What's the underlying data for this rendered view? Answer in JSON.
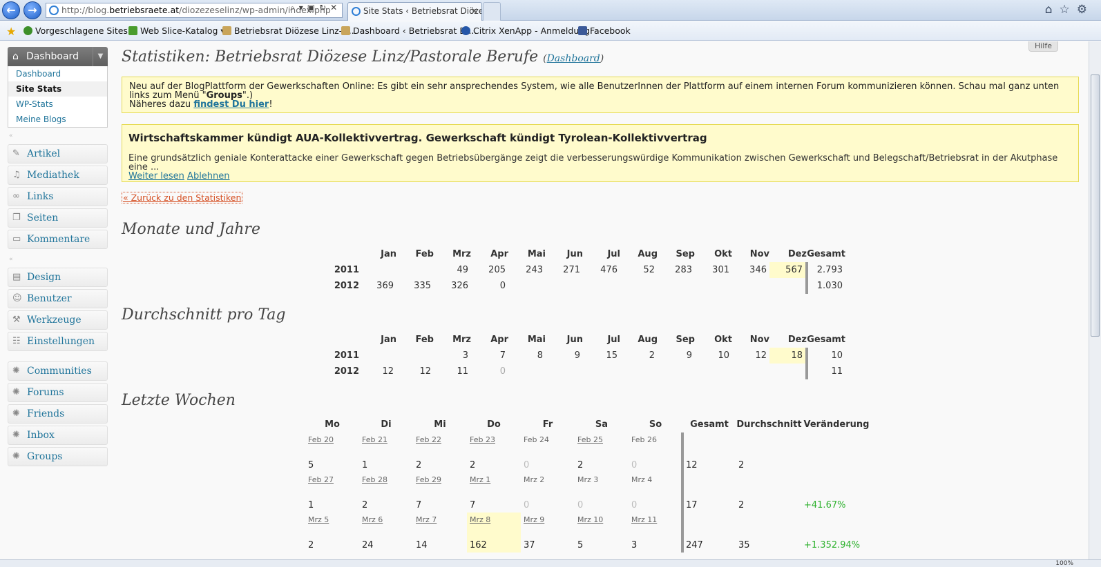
{
  "browser": {
    "url_prefix": "http://blog.",
    "url_domain": "betriebsraete.at",
    "url_path": "/diozezeselinz/wp-admin/index.php",
    "tab_title": "Site Stats ‹ Betriebsrat Diöze...",
    "tab_close": "✕",
    "favorites": [
      {
        "label": "Vorgeschlagene Sites ▾"
      },
      {
        "label": "Web Slice-Katalog ▾"
      },
      {
        "label": "Betriebsrat Diözese Linz-P..."
      },
      {
        "label": "Dashboard ‹ Betriebsrat Di..."
      },
      {
        "label": "Citrix XenApp - Anmeldung"
      },
      {
        "label": "Facebook"
      }
    ],
    "zoom": "100%",
    "colors": {
      "link": "#21759b",
      "notice_bg": "#fffbcc",
      "positive": "#2db12d",
      "back_link": "#d54e21"
    }
  },
  "sidebar": {
    "dashboard_label": "Dashboard",
    "sub_items": [
      "Dashboard",
      "Site Stats",
      "WP-Stats",
      "Meine Blogs"
    ],
    "group1": [
      "Artikel",
      "Mediathek",
      "Links",
      "Seiten",
      "Kommentare"
    ],
    "group2": [
      "Design",
      "Benutzer",
      "Werkzeuge",
      "Einstellungen"
    ],
    "group3": [
      "Communities",
      "Forums",
      "Friends",
      "Inbox",
      "Groups"
    ]
  },
  "main": {
    "help_label": "Hilfe",
    "title": "Statistiken: Betriebsrat Diözese Linz/Pastorale Berufe",
    "title_link": "Dashboard",
    "notice1": {
      "text_a": "Neu auf der BlogPlattform der Gewerkschaften Online: Es gibt ein sehr ansprechendes System, wie alle BenutzerInnen der Plattform auf einem internen Forum kommunizieren können. Schau mal ganz unten links zum Menü \"",
      "bold": "Groups",
      "text_b": "\".)",
      "line2_a": "Näheres dazu ",
      "link": "findest Du hier",
      "line2_b": "!"
    },
    "notice2": {
      "heading": "Wirtschaftskammer kündigt AUA-Kollektivvertrag. Gewerkschaft kündigt Tyrolean-Kollektivvertrag",
      "text": "Eine grundsätzlich geniale Konterattacke einer Gewerkschaft gegen Betriebsübergänge zeigt die verbesserungswürdige Kommunikation zwischen Gewerkschaft und Belegschaft/Betriebsrat in der Akutphase eine ...",
      "read_more": "Weiter lesen",
      "dismiss": "Ablehnen"
    },
    "back_link": "« Zurück zu den Statistiken",
    "months_title": "Monate und Jahre",
    "avg_title": "Durchschnitt pro Tag",
    "weeks_title": "Letzte Wochen",
    "month_headers": [
      "Jan",
      "Feb",
      "Mrz",
      "Apr",
      "Mai",
      "Jun",
      "Jul",
      "Aug",
      "Sep",
      "Okt",
      "Nov",
      "Dez",
      "Gesamt"
    ],
    "months": [
      {
        "year": "2011",
        "values": [
          "",
          "",
          "49",
          "205",
          "243",
          "271",
          "476",
          "52",
          "283",
          "301",
          "346",
          "567"
        ],
        "total": "2.793"
      },
      {
        "year": "2012",
        "values": [
          "369",
          "335",
          "326",
          "0",
          "",
          "",
          "",
          "",
          "",
          "",
          "",
          ""
        ],
        "total": "1.030"
      }
    ],
    "avg": [
      {
        "year": "2011",
        "values": [
          "",
          "",
          "3",
          "7",
          "8",
          "9",
          "15",
          "2",
          "9",
          "10",
          "12",
          "18"
        ],
        "total": "10"
      },
      {
        "year": "2012",
        "values": [
          "12",
          "12",
          "11",
          "0",
          "",
          "",
          "",
          "",
          "",
          "",
          "",
          ""
        ],
        "total": "11"
      }
    ],
    "week_headers": [
      "Mo",
      "Di",
      "Mi",
      "Do",
      "Fr",
      "Sa",
      "So",
      "Gesamt",
      "Durchschnitt",
      "Veränderung"
    ],
    "weeks": [
      {
        "days": [
          {
            "date": "Feb 20",
            "value": "5",
            "link": true
          },
          {
            "date": "Feb 21",
            "value": "1",
            "link": true
          },
          {
            "date": "Feb 22",
            "value": "2",
            "link": true
          },
          {
            "date": "Feb 23",
            "value": "2",
            "link": true
          },
          {
            "date": "Feb 24",
            "value": "0",
            "link": false
          },
          {
            "date": "Feb 25",
            "value": "2",
            "link": true
          },
          {
            "date": "Feb 26",
            "value": "0",
            "link": false
          }
        ],
        "total": "12",
        "avg": "2",
        "change": ""
      },
      {
        "days": [
          {
            "date": "Feb 27",
            "value": "1",
            "link": true
          },
          {
            "date": "Feb 28",
            "value": "2",
            "link": true
          },
          {
            "date": "Feb 29",
            "value": "7",
            "link": true
          },
          {
            "date": "Mrz 1",
            "value": "7",
            "link": true
          },
          {
            "date": "Mrz 2",
            "value": "0",
            "link": false
          },
          {
            "date": "Mrz 3",
            "value": "0",
            "link": false
          },
          {
            "date": "Mrz 4",
            "value": "0",
            "link": false
          }
        ],
        "total": "17",
        "avg": "2",
        "change": "+41.67%"
      },
      {
        "days": [
          {
            "date": "Mrz 5",
            "value": "2",
            "link": true
          },
          {
            "date": "Mrz 6",
            "value": "24",
            "link": true
          },
          {
            "date": "Mrz 7",
            "value": "14",
            "link": true
          },
          {
            "date": "Mrz 8",
            "value": "162",
            "link": true
          },
          {
            "date": "Mrz 9",
            "value": "37",
            "link": true
          },
          {
            "date": "Mrz 10",
            "value": "5",
            "link": true
          },
          {
            "date": "Mrz 11",
            "value": "3",
            "link": true
          }
        ],
        "total": "247",
        "avg": "35",
        "change": "+1.352.94%"
      }
    ]
  }
}
